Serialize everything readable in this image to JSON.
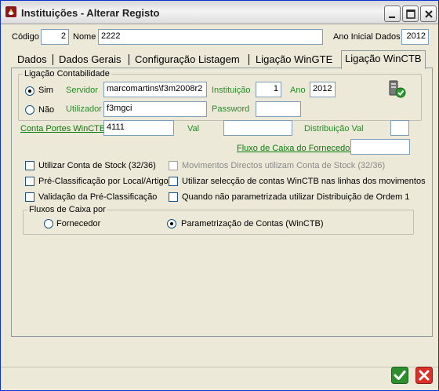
{
  "window": {
    "title": "Instituições - Alterar Registo",
    "controls": {
      "minimize": "minimize-icon",
      "maximize": "maximize-icon",
      "close": "close-icon"
    }
  },
  "header": {
    "codigo_label": "Código",
    "codigo_value": "2",
    "nome_label": "Nome",
    "nome_value": "2222",
    "ano_inicial_label": "Ano Inicial Dados",
    "ano_inicial_value": "2012"
  },
  "tabs": [
    {
      "label": "Dados",
      "active": false
    },
    {
      "label": "Dados Gerais",
      "active": false
    },
    {
      "label": "Configuração Listagem",
      "active": false
    },
    {
      "label": "Ligação WinGTE",
      "active": false
    },
    {
      "label": "Ligação WinCTB",
      "active": true
    }
  ],
  "ligacao": {
    "group_title": "Ligação Contabilidade",
    "sim_label": "Sim",
    "nao_label": "Não",
    "sim_selected": true,
    "servidor_label": "Servidor",
    "servidor_value": "marcomartins\\f3m2008r2",
    "instituicao_label": "Instituição",
    "instituicao_value": "1",
    "ano_label": "Ano",
    "ano_value": "2012",
    "utilizador_label": "Utilizador",
    "utilizador_value": "f3mgci",
    "password_label": "Password",
    "password_value": "",
    "status_icon": "connection-ok-icon"
  },
  "conta_portes": {
    "label": "Conta Portes WinCTB",
    "value": "4111",
    "val_label": "Val",
    "val_value": "",
    "distribuicao_label": "Distribuição Val",
    "distribuicao_value": ""
  },
  "fluxo_fornecedor": {
    "label": "Fluxo de Caixa do Fornecedor",
    "value": ""
  },
  "checkboxes": {
    "left": [
      {
        "label": "Utilizar Conta de Stock (32/36)",
        "checked": false,
        "enabled": true
      },
      {
        "label": "Pré-Classificação por Local/Artigo",
        "checked": false,
        "enabled": true
      },
      {
        "label": "Validação da Pré-Classificação",
        "checked": false,
        "enabled": true
      }
    ],
    "right": [
      {
        "label": "Movimentos Directos utilizam Conta de Stock (32/36)",
        "checked": false,
        "enabled": false
      },
      {
        "label": "Utilizar selecção de contas WinCTB nas linhas dos movimentos",
        "checked": false,
        "enabled": true
      },
      {
        "label": "Quando não parametrizada utilizar Distribuição de Ordem 1",
        "checked": false,
        "enabled": true
      }
    ]
  },
  "fluxos": {
    "group_title": "Fluxos de Caixa por",
    "fornecedor_label": "Fornecedor",
    "parametrizacao_label": "Parametrização de Contas (WinCTB)",
    "selected": "parametrizacao"
  },
  "actions": {
    "confirm_icon": "check-icon",
    "cancel_icon": "cancel-x-icon"
  }
}
